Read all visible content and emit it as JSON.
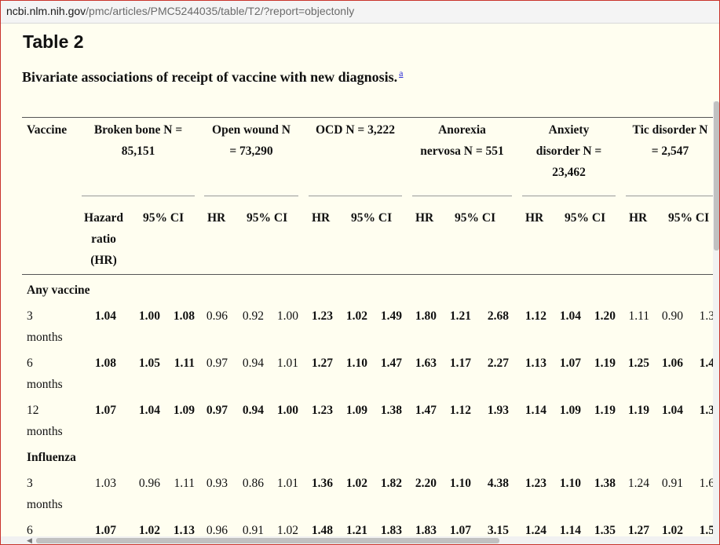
{
  "browser": {
    "url_domain": "ncbi.nlm.nih.gov",
    "url_path": "/pmc/articles/PMC5244035/table/T2/?report=objectonly"
  },
  "page": {
    "title": "Table 2",
    "caption": "Bivariate associations of receipt of vaccine with new diagnosis.",
    "caption_footnote": "a"
  },
  "table": {
    "vaccine_header": "Vaccine",
    "groups": [
      {
        "name": "Broken bone N = 85,151",
        "line1": "Broken bone N =",
        "line2": "85,151",
        "line3": ""
      },
      {
        "name": "Open wound N = 73,290",
        "line1": "Open wound N",
        "line2": "= 73,290",
        "line3": ""
      },
      {
        "name": "OCD N = 3,222",
        "line1": "OCD N = 3,222",
        "line2": "",
        "line3": ""
      },
      {
        "name": "Anorexia nervosa N = 551",
        "line1": "Anorexia",
        "line2": "nervosa N = 551",
        "line3": ""
      },
      {
        "name": "Anxiety disorder N = 23,462",
        "line1": "Anxiety",
        "line2": "disorder N =",
        "line3": "23,462"
      },
      {
        "name": "Tic disorder N = 2,547",
        "line1": "Tic disorder N",
        "line2": "= 2,547",
        "line3": ""
      }
    ],
    "subheaders": {
      "hazard_l1": "Hazard",
      "hazard_l2": "ratio",
      "hazard_l3": "(HR)",
      "hr": "HR",
      "ci": "95% CI"
    },
    "sections": [
      {
        "title": "Any vaccine",
        "rows": [
          {
            "label_l1": "3",
            "label_l2": "months",
            "cells": [
              [
                "1.04",
                "1.00",
                "1.08"
              ],
              [
                "0.96",
                "0.92",
                "1.00"
              ],
              [
                "1.23",
                "1.02",
                "1.49"
              ],
              [
                "1.80",
                "1.21",
                "2.68"
              ],
              [
                "1.12",
                "1.04",
                "1.20"
              ],
              [
                "1.11",
                "0.90",
                "1.3"
              ]
            ],
            "bold": [
              true,
              false,
              true,
              true,
              true,
              false
            ]
          },
          {
            "label_l1": "6",
            "label_l2": "months",
            "cells": [
              [
                "1.08",
                "1.05",
                "1.11"
              ],
              [
                "0.97",
                "0.94",
                "1.01"
              ],
              [
                "1.27",
                "1.10",
                "1.47"
              ],
              [
                "1.63",
                "1.17",
                "2.27"
              ],
              [
                "1.13",
                "1.07",
                "1.19"
              ],
              [
                "1.25",
                "1.06",
                "1.4"
              ]
            ],
            "bold": [
              true,
              false,
              true,
              true,
              true,
              true
            ]
          },
          {
            "label_l1": "12",
            "label_l2": "months",
            "cells": [
              [
                "1.07",
                "1.04",
                "1.09"
              ],
              [
                "0.97",
                "0.94",
                "1.00"
              ],
              [
                "1.23",
                "1.09",
                "1.38"
              ],
              [
                "1.47",
                "1.12",
                "1.93"
              ],
              [
                "1.14",
                "1.09",
                "1.19"
              ],
              [
                "1.19",
                "1.04",
                "1.3"
              ]
            ],
            "bold": [
              true,
              true,
              true,
              true,
              true,
              true
            ]
          }
        ]
      },
      {
        "title": "Influenza",
        "rows": [
          {
            "label_l1": "3",
            "label_l2": "months",
            "cells": [
              [
                "1.03",
                "0.96",
                "1.11"
              ],
              [
                "0.93",
                "0.86",
                "1.01"
              ],
              [
                "1.36",
                "1.02",
                "1.82"
              ],
              [
                "2.20",
                "1.10",
                "4.38"
              ],
              [
                "1.23",
                "1.10",
                "1.38"
              ],
              [
                "1.24",
                "0.91",
                "1.6"
              ]
            ],
            "bold": [
              false,
              false,
              true,
              true,
              true,
              false
            ]
          },
          {
            "label_l1": "6",
            "label_l2": "",
            "cells": [
              [
                "1.07",
                "1.02",
                "1.13"
              ],
              [
                "0.96",
                "0.91",
                "1.02"
              ],
              [
                "1.48",
                "1.21",
                "1.83"
              ],
              [
                "1.83",
                "1.07",
                "3.15"
              ],
              [
                "1.24",
                "1.14",
                "1.35"
              ],
              [
                "1.27",
                "1.02",
                "1.5"
              ]
            ],
            "bold": [
              true,
              false,
              true,
              true,
              true,
              true
            ]
          }
        ]
      }
    ]
  }
}
